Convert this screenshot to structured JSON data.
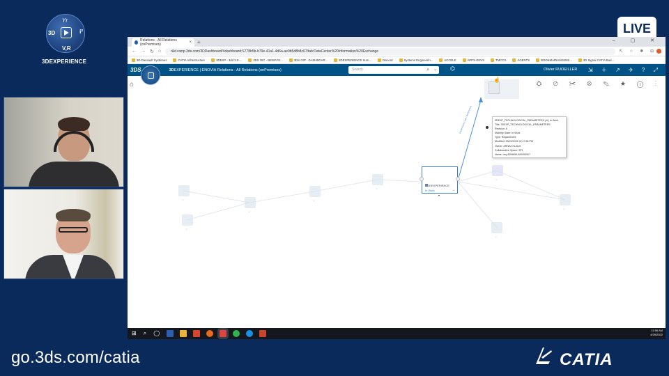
{
  "brand": {
    "logo_top": "Yr",
    "logo_left": "3D",
    "logo_right": "i²",
    "logo_bottom": "V,R",
    "name": "3DEXPERIENCE",
    "live_badge": "LIVE",
    "footer_url": "go.3ds.com/catia",
    "product_wordmark": "CATIA"
  },
  "browser": {
    "tab_title": "Relations - All Relations (onPremises)",
    "tab_close": "×",
    "new_tab": "+",
    "window_controls": "– ▢ ✕",
    "nav": {
      "back": "←",
      "forward": "→",
      "reload": "↻",
      "home": "⌂"
    },
    "url": "r&d.ramp.3ds.com/3DDashboard/#dashboard:S778b5b-b79e-41a1-4d6a-ae9b5d8b8c07/tab:DataCenter%20Information%20Exchange",
    "addr_icons": "⇱ ☆ ✱ ⊞",
    "bookmarks": [
      "3D Dassault Systèmes",
      "CATIA Infrastructure",
      "3DEXP - 3dd 3.0-...",
      "3DS OIC - BEWAYE...",
      "3DS OIP - DASHBOAR...",
      "3DEXPERIENCE Sum...",
      "Discord",
      "Systems Engineerin...",
      "ACCELE",
      "APPS-ENVS",
      "TMCCS",
      "AGENTS",
      "BOOKMARKS/GENE...",
      "3D Signal CATIA Bud..."
    ]
  },
  "app": {
    "ds_mark": "3DS",
    "brand_bold": "3D",
    "brand_rest": "EXPERIENCE | ENOVIA",
    "title_rest": "Relations - All Relations (onPremises)",
    "search_placeholder": "Search",
    "search_icon": "⌕",
    "search_drop": "⌄",
    "tag_icon": "⌬",
    "user": "Olivier RUOEILLER",
    "header_icons": "⇲ ＋ ↗ ✈ ? ⤢",
    "tools": "⛭ ⊘ ✂ ⊗ ✎ ★ ⓘ ⋮",
    "home_icon": "⌂"
  },
  "graph": {
    "selected_node_label": "3DEXPERIENCE",
    "selected_node_state": "In Work",
    "selected_node_chevron": "⌄",
    "selected_node_arrow": "▾",
    "edge_label": "Implement Link / Reference",
    "cursor": "☝",
    "tooltip": [
      "3DEXP_TECHNOLOGICAL_PARAMETERS | A | In Work",
      "Title: 3DEXP_TECHNOLOGICAL_PARAMETERS",
      "Revision: A",
      "Maturity State: In Work",
      "Type: Requirement",
      "Modified: 03/22/2022 02:17:56 PM",
      "Owner: ARNEZ KLAUS",
      "Collaborative Space: 3P1",
      "Name: req-4399659-000000007"
    ]
  },
  "taskbar": {
    "start": "⊞",
    "search": "⌕",
    "task_view": "◯",
    "time": "11:56 AM",
    "date": "4/29/2022"
  }
}
